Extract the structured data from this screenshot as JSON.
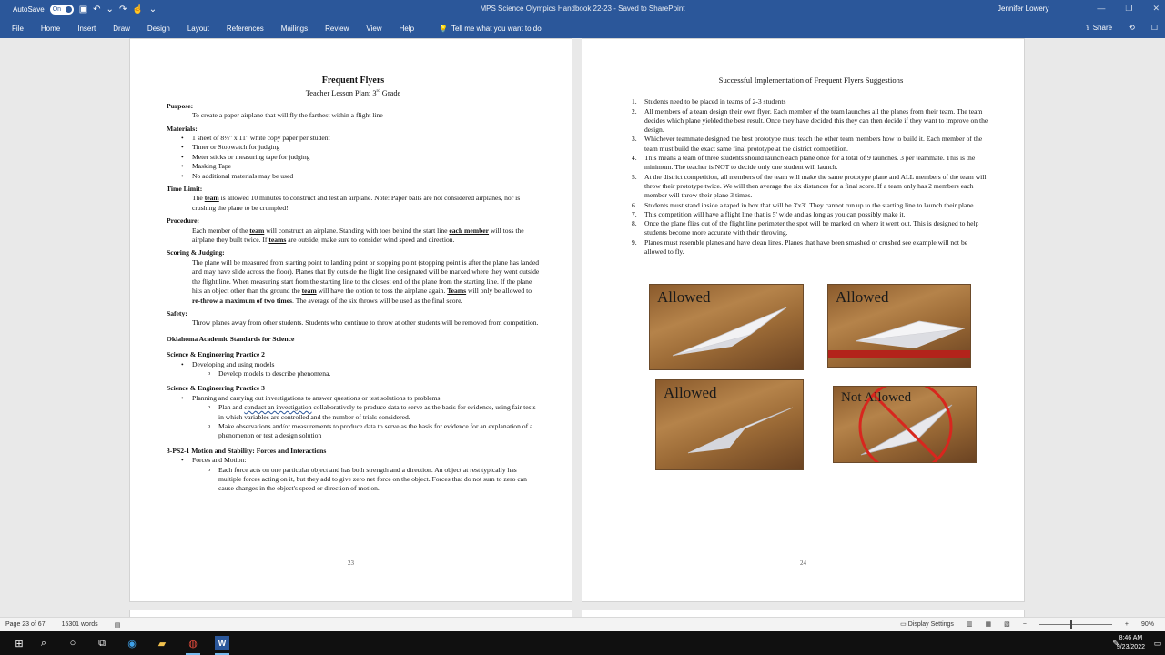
{
  "titlebar": {
    "autosave_label": "AutoSave",
    "autosave_state": "On",
    "doc_title": "MPS Science Olympics Handbook 22-23  -  Saved to SharePoint",
    "user": "Jennifer Lowery"
  },
  "ribbon": {
    "tabs": [
      "File",
      "Home",
      "Insert",
      "Draw",
      "Design",
      "Layout",
      "References",
      "Mailings",
      "Review",
      "View",
      "Help"
    ],
    "tell_me": "Tell me what you want to do",
    "share": "Share"
  },
  "page23": {
    "title": "Frequent Flyers",
    "subtitle_a": "Teacher Lesson Plan: 3",
    "subtitle_sup": "rd",
    "subtitle_b": " Grade",
    "purpose_h": "Purpose:",
    "purpose": "To create a paper airplane that will fly the farthest within a flight line",
    "materials_h": "Materials:",
    "materials": [
      "1 sheet of 8½\" x 11\" white copy paper per student",
      "Timer or Stopwatch for judging",
      "Meter sticks or measuring tape for judging",
      "Masking Tape",
      "No additional materials may be used"
    ],
    "time_h": "Time Limit:",
    "time_a": "The ",
    "time_team": "team",
    "time_b": " is allowed 10 minutes to construct and test an airplane.  Note: Paper balls are not considered airplanes, nor is crushing the plane to be crumpled!",
    "proc_h": "Procedure:",
    "proc_a": "Each member of the ",
    "proc_team": "team",
    "proc_b": " will construct an airplane. Standing with toes behind the start line ",
    "proc_each": "each member",
    "proc_c": " will toss the airplane they built twice. If ",
    "proc_teams": "teams",
    "proc_d": " are outside, make sure to consider wind speed and direction.",
    "scoring_h": "Scoring & Judging:",
    "scoring_a": "The plane will be measured from starting point to landing point or stopping point (stopping point is after the plane has landed and may have slide across the floor). Planes that fly outside the flight line designated will be marked where they went outside the flight line. When measuring start from the starting line to the closest end of the plane from the starting line. If the plane hits an object other than the ground the ",
    "scoring_team": "team",
    "scoring_b": " will have the option to toss the airplane again. ",
    "scoring_teams": "Teams",
    "scoring_c": " will only be allowed to ",
    "scoring_rethrow": "re-throw a maximum of two times",
    "scoring_d": ". The average of the six throws will be used as the final score.",
    "safety_h": "Safety:",
    "safety": "Throw planes away from other students. Students who continue to throw at other students will be removed from competition.",
    "oas_h": "Oklahoma Academic Standards for Science",
    "sep2_h": "Science & Engineering Practice 2",
    "sep2_b": "Developing and using models",
    "sep2_o": "Develop models to describe phenomena.",
    "sep3_h": "Science & Engineering Practice 3",
    "sep3_b": "Planning and carrying out investigations to answer questions or test solutions to problems",
    "sep3_o1_a": "Plan and ",
    "sep3_o1_wavy": "conduct an investigation",
    "sep3_o1_b": " collaboratively to produce data to serve as the basis for evidence, using fair tests in which variables are controlled and the number of trials considered.",
    "sep3_o2": "Make observations and/or measurements to produce data to serve as the basis for evidence for an explanation of a phenomenon or test a design solution",
    "ps2_h": "3-PS2-1 Motion and Stability: Forces and Interactions",
    "ps2_b": "Forces and Motion:",
    "ps2_o": "Each force acts on one particular object and has both strength and a direction. An object at rest typically has multiple forces acting on it, but they add to give zero net force on the object. Forces that do not sum to zero can cause changes in the object's speed or direction of motion.",
    "page_number": "23"
  },
  "page24": {
    "title": "Successful Implementation of Frequent Flyers Suggestions",
    "items": [
      "Students need to be placed in teams of 2-3 students",
      "All members of a team design their own flyer. Each member of the team launches all the planes from their team. The team decides which plane yielded the best result. Once they have decided this they can then decide if they want to improve on the design.",
      "Whichever teammate designed the best prototype must teach the other team members how to build it. Each member of the team must build the exact same final prototype at the district competition.",
      "This means a team of three students should launch each plane once for a total of 9 launches. 3 per teammate. This is the minimum. The teacher is NOT to decide only one student will launch.",
      "At the district competition, all members of the team will make the same prototype plane and ALL members of the team will throw their prototype twice. We will then average the six distances for a final score. If a team only has 2 members each member will throw their plane 3 times.",
      "Students must stand inside a taped in box that will be 3'x3'. They cannot run up to the starting line to launch their plane.",
      "This competition will have a flight line that is 5' wide and as long as you can possibly make it.",
      "Once the plane flies out of the flight line perimeter the spot will be marked on where it went out. This is designed to help students become more accurate with their throwing.",
      "Planes must resemble planes and have clean lines. Planes that have been smashed or crushed see example will not be allowed to fly."
    ],
    "photos": [
      "Allowed",
      "Allowed",
      "Allowed",
      "Not Allowed"
    ],
    "page_number": "24"
  },
  "status": {
    "page": "Page 23 of 67",
    "words": "15301 words",
    "display_settings": "Display Settings",
    "zoom": "90%"
  },
  "taskbar": {
    "time": "8:46 AM",
    "date": "9/23/2022"
  }
}
